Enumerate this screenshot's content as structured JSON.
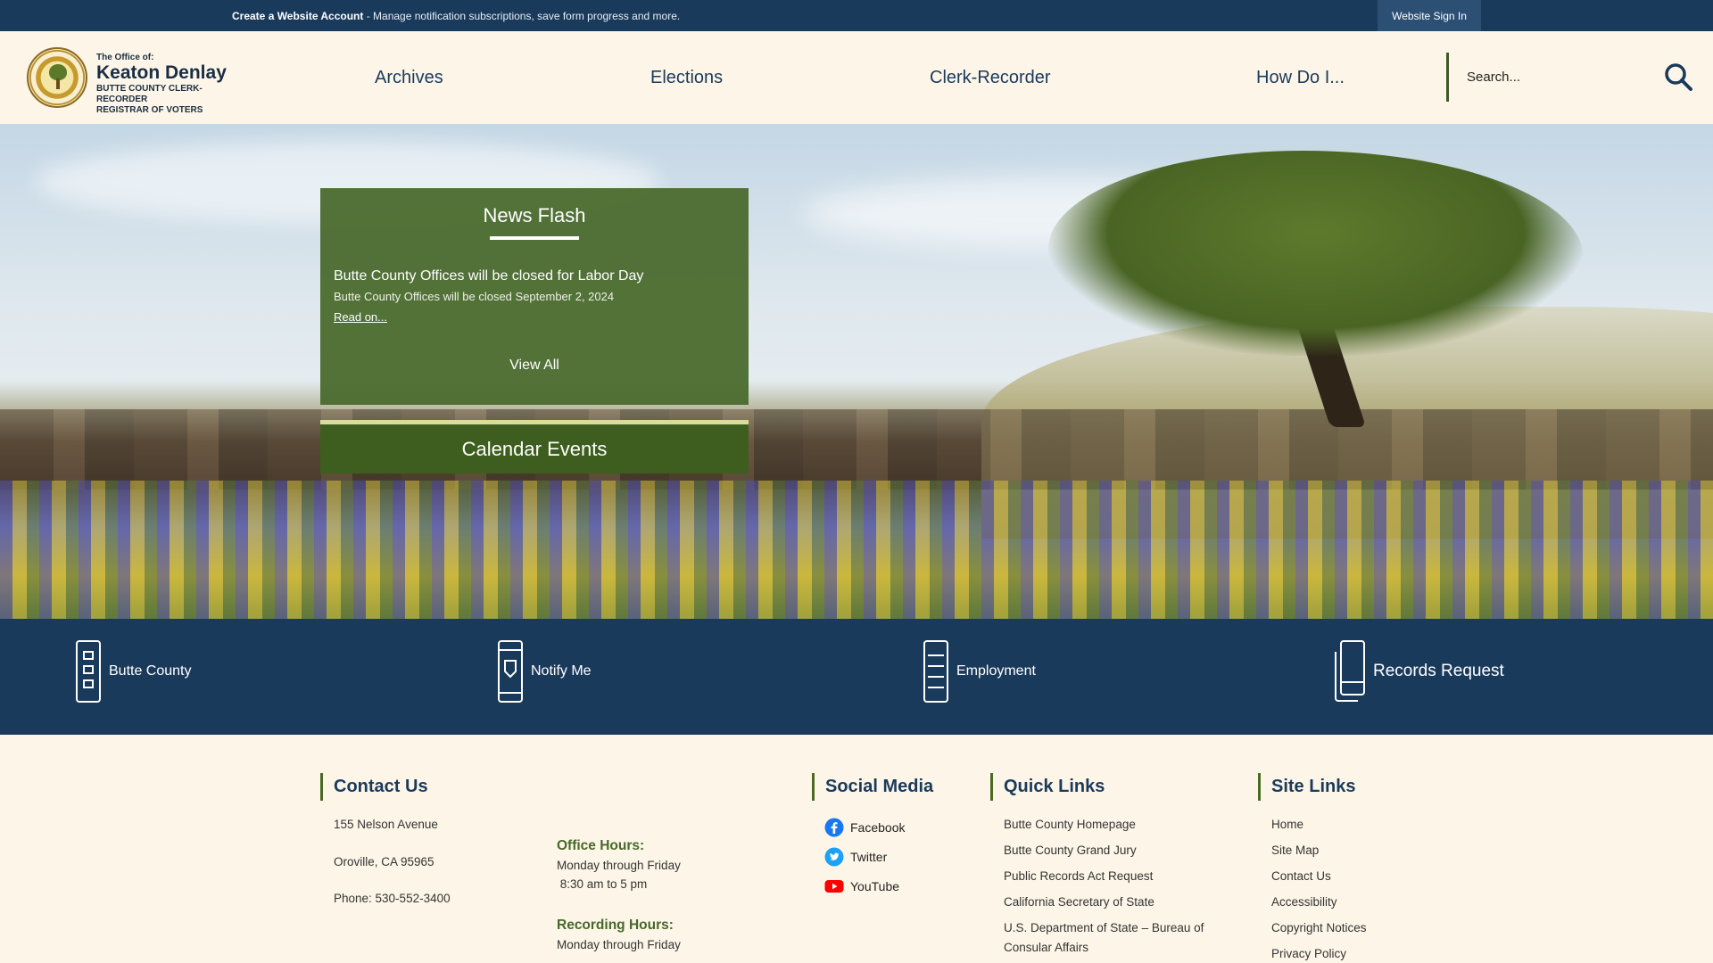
{
  "topbar": {
    "create_account": "Create a Website Account",
    "create_desc": " - Manage notification subscriptions, save form progress and more.",
    "sign_in": "Website Sign In"
  },
  "logo": {
    "line1": "The Office of:",
    "line2": "Keaton Denlay",
    "line3": "BUTTE COUNTY CLERK-RECORDER",
    "line4": "REGISTRAR OF VOTERS"
  },
  "nav": {
    "items": [
      {
        "label": "Archives"
      },
      {
        "label": "Elections"
      },
      {
        "label": "Clerk-Recorder"
      },
      {
        "label": "How Do I..."
      }
    ]
  },
  "search": {
    "placeholder": "Search...",
    "icon": "search-icon"
  },
  "news": {
    "title": "News Flash",
    "headline": "Butte County Offices will be closed for Labor Day",
    "summary": "Butte County Offices will be closed September 2, 2024",
    "read_on": "Read on...",
    "view_all": "View All"
  },
  "calendar": {
    "title": "Calendar Events"
  },
  "quick_links": [
    {
      "label": "Butte County",
      "icon": "building-icon"
    },
    {
      "label": "Notify Me",
      "icon": "notify-icon"
    },
    {
      "label": "Employment",
      "icon": "employment-icon"
    },
    {
      "label": "Records Request",
      "icon": "records-icon"
    }
  ],
  "footer": {
    "contact": {
      "heading": "Contact Us",
      "address1": "155 Nelson Avenue",
      "address2": "Oroville, CA 95965",
      "phone": "Phone: 530-552-3400",
      "office_hours_title": "Office Hours:",
      "office_hours_days": "Monday through Friday",
      "office_hours_time": " 8:30 am to 5 pm",
      "recording_hours_title": "Recording Hours:",
      "recording_hours_days": "Monday through Friday"
    },
    "social": {
      "heading": "Social Media",
      "items": [
        {
          "label": "Facebook",
          "icon": "facebook-icon"
        },
        {
          "label": "Twitter",
          "icon": "twitter-icon"
        },
        {
          "label": "YouTube",
          "icon": "youtube-icon"
        }
      ]
    },
    "quick": {
      "heading": "Quick Links",
      "items": [
        "Butte County Homepage",
        "Butte County Grand Jury",
        "Public Records Act Request",
        "California Secretary of State",
        "U.S. Department of State – Bureau of",
        "Consular Affairs"
      ]
    },
    "site": {
      "heading": "Site Links",
      "items": [
        "Home",
        "Site Map",
        "Contact Us",
        "Accessibility",
        "Copyright Notices",
        "Privacy Policy"
      ]
    }
  },
  "colors": {
    "navy": "#1a3a5c",
    "green": "#47682a",
    "cream": "#fdf6e8"
  }
}
